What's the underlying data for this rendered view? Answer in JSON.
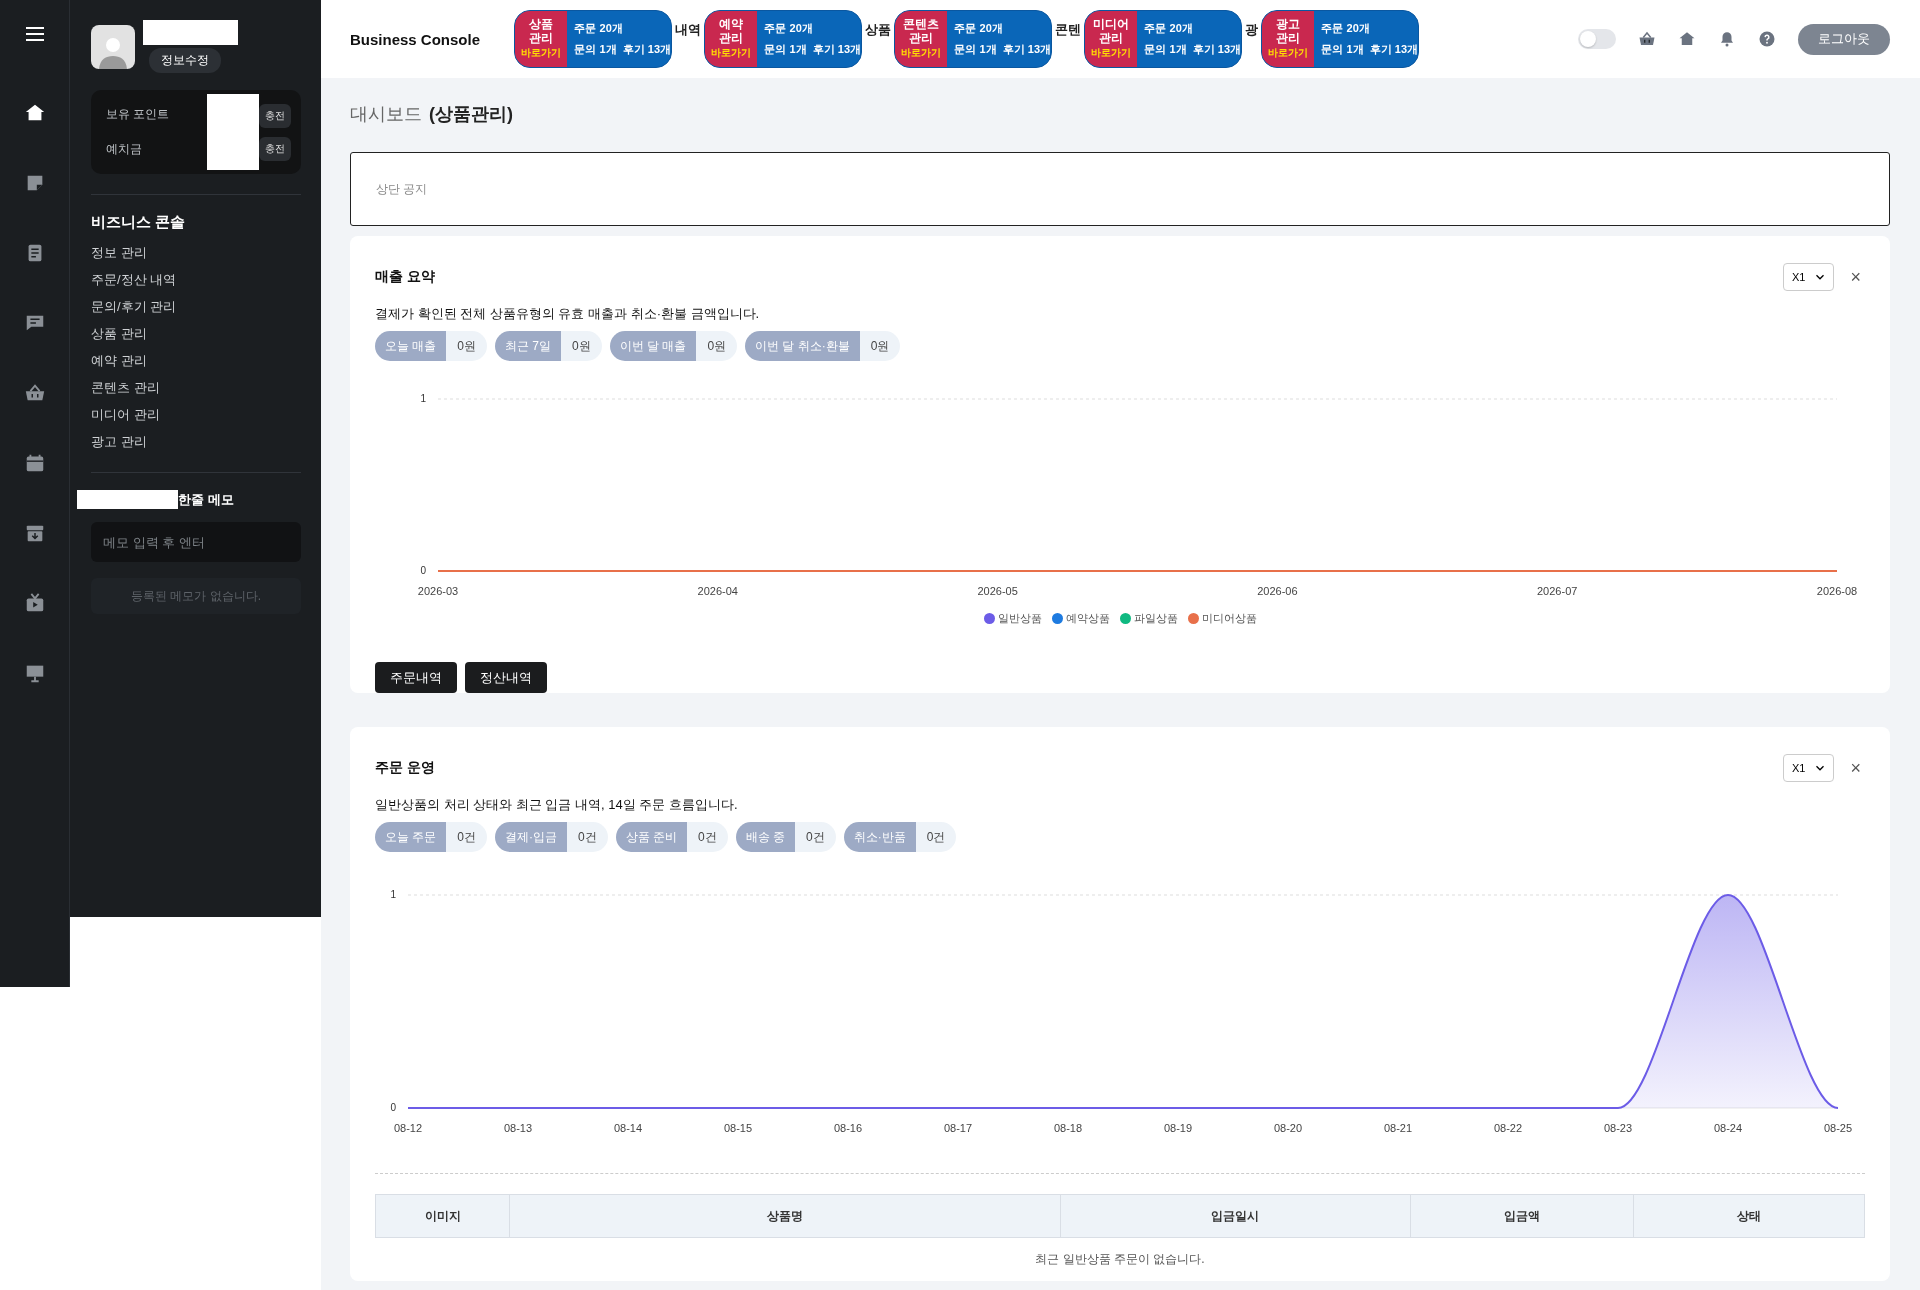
{
  "rail": {
    "items": [
      {
        "kind": "home",
        "selected": true
      },
      {
        "kind": "note",
        "selected": false
      },
      {
        "kind": "document",
        "selected": false
      },
      {
        "kind": "chat",
        "selected": false
      },
      {
        "kind": "basket",
        "selected": false
      },
      {
        "kind": "calendar",
        "selected": false
      },
      {
        "kind": "archive",
        "selected": false
      },
      {
        "kind": "tv",
        "selected": false
      },
      {
        "kind": "board",
        "selected": false
      }
    ]
  },
  "sidebar": {
    "profile_button": "정보수정",
    "wallet": [
      {
        "label": "보유 포인트",
        "button": "충전"
      },
      {
        "label": "예치금",
        "button": "충전"
      }
    ],
    "menu_title": "비즈니스 콘솔",
    "menu": [
      "정보 관리",
      "주문/정산 내역",
      "문의/후기 관리",
      "상품 관리",
      "예약 관리",
      "콘텐츠 관리",
      "미디어 관리",
      "광고 관리"
    ],
    "memo": {
      "title": "한줄 메모",
      "placeholder": "메모 입력 후 엔터",
      "empty": "등록된 메모가 없습니다."
    }
  },
  "topbar": {
    "brand": "Business Console",
    "shortcuts": [
      {
        "title": "상품 관리",
        "link": "바로가기",
        "orders": "주문 20개",
        "inquiries": "문의 1개",
        "reviews": "후기 13개",
        "after": "내역"
      },
      {
        "title": "예약 관리",
        "link": "바로가기",
        "orders": "주문 20개",
        "inquiries": "문의 1개",
        "reviews": "후기 13개",
        "after": "상품"
      },
      {
        "title": "콘텐츠 관리",
        "link": "바로가기",
        "orders": "주문 20개",
        "inquiries": "문의 1개",
        "reviews": "후기 13개",
        "after": "콘텐"
      },
      {
        "title": "미디어 관리",
        "link": "바로가기",
        "orders": "주문 20개",
        "inquiries": "문의 1개",
        "reviews": "후기 13개",
        "after": "광"
      },
      {
        "title": "광고 관리",
        "link": "바로가기",
        "orders": "주문 20개",
        "inquiries": "문의 1개",
        "reviews": "후기 13개"
      }
    ],
    "dark_mode": {
      "on": false
    },
    "logout": "로그아웃"
  },
  "page": {
    "title": "대시보드",
    "subtitle": "(상품관리)",
    "notice": "상단 공지"
  },
  "sales_card": {
    "title": "매출 요약",
    "description": "결제가 확인된 전체 상품유형의 유효 매출과 취소·환불 금액입니다.",
    "scale": "X1",
    "close": "×",
    "stats": [
      {
        "label": "오늘 매출",
        "value": "0원"
      },
      {
        "label": "최근 7일",
        "value": "0원"
      },
      {
        "label": "이번 달 매출",
        "value": "0원"
      },
      {
        "label": "이번 달 취소·환불",
        "value": "0원"
      }
    ],
    "chart_data": {
      "type": "line",
      "categories": [
        "2026-03",
        "2026-04",
        "2026-05",
        "2026-06",
        "2026-07",
        "2026-08"
      ],
      "ylim": [
        0,
        1
      ],
      "yticks": [
        0,
        1
      ],
      "legend": "bottom",
      "series": [
        {
          "name": "일반상품",
          "color": "#6c5ce7",
          "values": [
            null,
            null,
            null,
            null,
            null,
            null
          ]
        },
        {
          "name": "예약상품",
          "color": "#1e7be0",
          "values": [
            null,
            null,
            null,
            null,
            null,
            null
          ]
        },
        {
          "name": "파일상품",
          "color": "#10b981",
          "values": [
            null,
            null,
            null,
            null,
            null,
            null
          ]
        },
        {
          "name": "미디어상품",
          "color": "#e8704a",
          "values": [
            0,
            0,
            0,
            0,
            0,
            0
          ]
        }
      ]
    },
    "buttons": [
      "주문내역",
      "정산내역"
    ]
  },
  "orders_card": {
    "title": "주문 운영",
    "description": "일반상품의 처리 상태와 최근 입금 내역, 14일 주문 흐름입니다.",
    "scale": "X1",
    "close": "×",
    "stats": [
      {
        "label": "오늘 주문",
        "value": "0건"
      },
      {
        "label": "결제·입금",
        "value": "0건"
      },
      {
        "label": "상품 준비",
        "value": "0건"
      },
      {
        "label": "배송 중",
        "value": "0건"
      },
      {
        "label": "취소·반품",
        "value": "0건"
      }
    ],
    "chart_data": {
      "type": "area",
      "categories": [
        "08-12",
        "08-13",
        "08-14",
        "08-15",
        "08-16",
        "08-17",
        "08-18",
        "08-19",
        "08-20",
        "08-21",
        "08-22",
        "08-23",
        "08-24",
        "08-25"
      ],
      "ylim": [
        0,
        1
      ],
      "yticks": [
        0,
        1
      ],
      "series": [
        {
          "color": "#6c5ce7",
          "values": [
            0,
            0,
            0,
            0,
            0,
            0,
            0,
            0,
            0,
            0,
            0,
            0,
            1,
            0
          ]
        }
      ]
    },
    "table": {
      "columns": [
        "이미지",
        "상품명",
        "입금일시",
        "입금액",
        "상태"
      ],
      "empty": "최근 일반상품 주문이 없습니다."
    }
  }
}
